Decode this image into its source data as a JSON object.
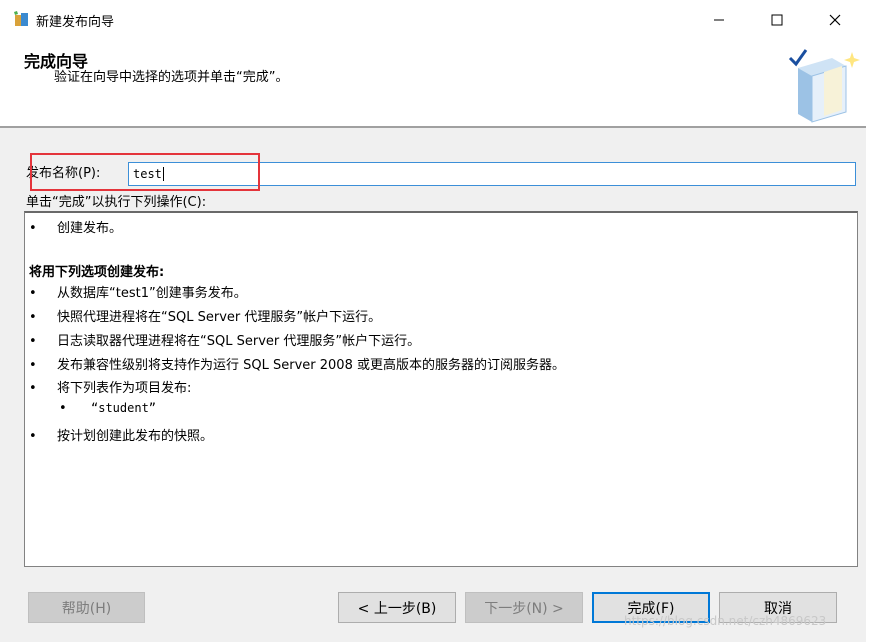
{
  "window": {
    "title": "新建发布向导",
    "app_icon": "wizard-app-icon",
    "controls": [
      "minimize-icon",
      "maximize-icon",
      "close-icon"
    ]
  },
  "header": {
    "title": "完成向导",
    "subtitle": "验证在向导中选择的选项并单击“完成”。"
  },
  "form": {
    "name_label": "发布名称(P):",
    "name_value": "test",
    "actions_label": "单击“完成”以执行下列操作(C):"
  },
  "summary": {
    "bullet_glyph": "•",
    "item_create": "创建发布。",
    "section_title": "将用下列选项创建发布:",
    "items": [
      "从数据库“test1”创建事务发布。",
      "快照代理进程将在“SQL Server 代理服务”帐户下运行。",
      "日志读取器代理进程将在“SQL Server 代理服务”帐户下运行。",
      "发布兼容性级别将支持作为运行 SQL Server 2008 或更高版本的服务器的订阅服务器。",
      "将下列表作为项目发布:"
    ],
    "article": "“student”",
    "item_snapshot": "按计划创建此发布的快照。"
  },
  "buttons": {
    "help": "帮助(H)",
    "back": "< 上一步(B)",
    "next": "下一步(N) >",
    "finish": "完成(F)",
    "cancel": "取消"
  },
  "watermark": "https://blog.csdn.net/czh4869623",
  "colors": {
    "accent": "#0078d7",
    "highlight_box": "#e4343b",
    "dialog_bg": "#f0f0f0"
  }
}
